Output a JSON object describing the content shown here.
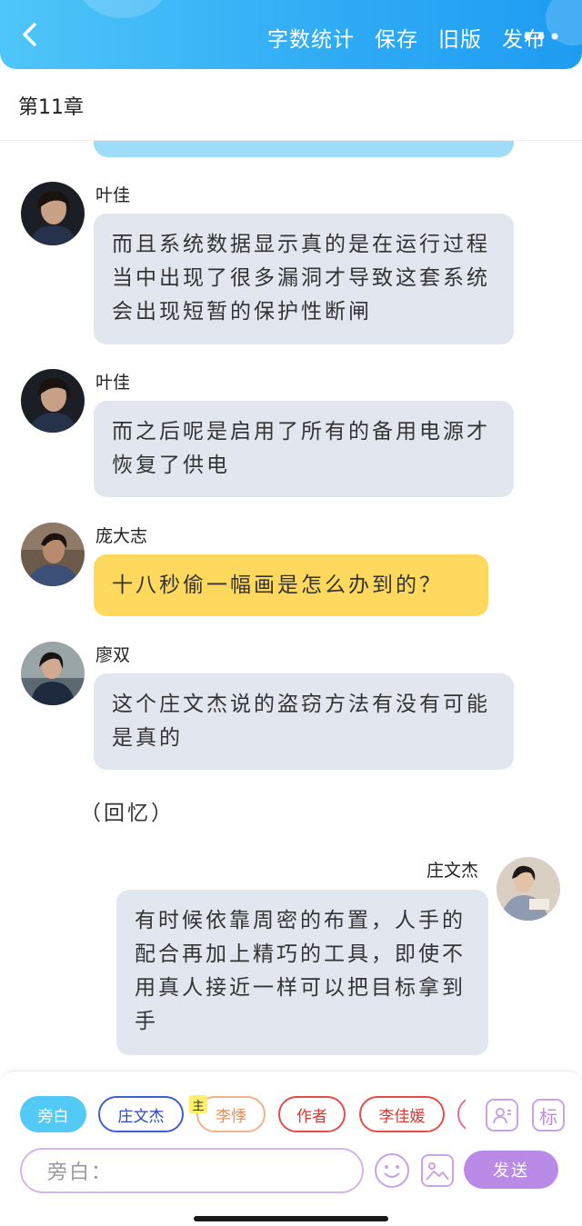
{
  "header": {
    "actions": [
      "字数统计",
      "保存",
      "旧版",
      "发布"
    ],
    "colors": {
      "bar": "#2eaaf5"
    }
  },
  "chapter": {
    "title": "第11章"
  },
  "messages": [
    {
      "side": "left",
      "name": "叶佳",
      "text": "而且系统数据显示真的是在运行过程当中出现了很多漏洞才导致这套系统会出现短暂的保护性断闸",
      "bubble": "grey"
    },
    {
      "side": "left",
      "name": "叶佳",
      "text": "而之后呢是启用了所有的备用电源才恢复了供电",
      "bubble": "grey"
    },
    {
      "side": "left",
      "name": "庞大志",
      "text": "十八秒偷一幅画是怎么办到的？",
      "bubble": "yellow"
    },
    {
      "side": "left",
      "name": "廖双",
      "text": "这个庄文杰说的盗窃方法有没有可能是真的",
      "bubble": "grey"
    },
    {
      "type": "narration",
      "text": "（回忆）"
    },
    {
      "side": "right",
      "name": "庄文杰",
      "text": "有时候依靠周密的布置，人手的配合再加上精巧的工具，即使不用真人接近一样可以把目标拿到手",
      "bubble": "grey"
    }
  ],
  "panel": {
    "roles": [
      "旁白",
      "庄文杰",
      "李悸",
      "作者",
      "李佳媛"
    ],
    "main_badge": "主",
    "mark_label": "标",
    "input_placeholder": "旁白：",
    "send_label": "发送"
  }
}
